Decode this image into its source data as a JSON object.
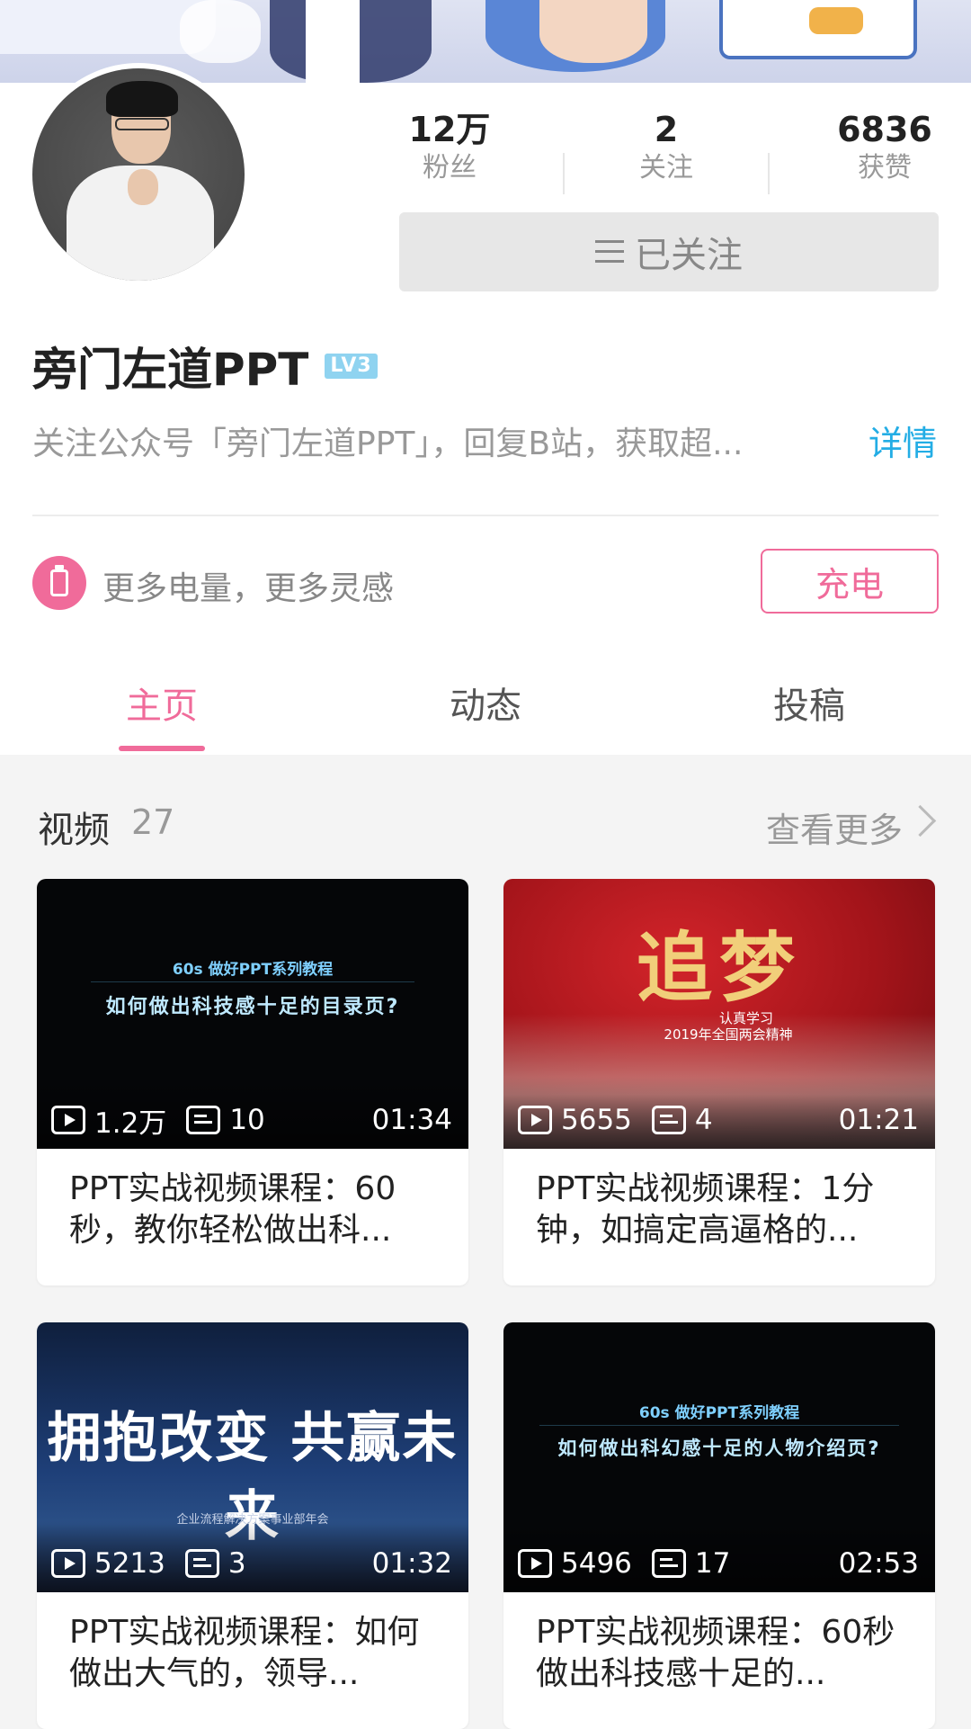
{
  "profile": {
    "stats": [
      {
        "value": "12万",
        "label": "粉丝"
      },
      {
        "value": "2",
        "label": "关注"
      },
      {
        "value": "6836",
        "label": "获赞"
      }
    ],
    "follow_button_label": "已关注",
    "username": "旁门左道PPT",
    "level_badge": "LV3",
    "description": "关注公众号「旁门左道PPT」，回复B站，获取超...",
    "detail_link": "详情",
    "charge_text": "更多电量，更多灵感",
    "charge_button": "充电"
  },
  "tabs": [
    {
      "label": "主页",
      "active": true
    },
    {
      "label": "动态",
      "active": false
    },
    {
      "label": "投稿",
      "active": false
    }
  ],
  "videos_section": {
    "title": "视频",
    "count": "27",
    "more_label": "查看更多"
  },
  "videos": [
    {
      "views": "1.2万",
      "danmaku": "10",
      "duration": "01:34",
      "title": "PPT实战视频课程：60秒，教你轻松做出科...",
      "thumb_lines": [
        "60s 做好PPT系列教程",
        "如何做出科技感十足的目录页?"
      ]
    },
    {
      "views": "5655",
      "danmaku": "4",
      "duration": "01:21",
      "title": "PPT实战视频课程：1分钟，如搞定高逼格的...",
      "thumb_lines": [
        "追梦",
        "认真学习",
        "2019年全国两会精神"
      ]
    },
    {
      "views": "5213",
      "danmaku": "3",
      "duration": "01:32",
      "title": "PPT实战视频课程：如何做出大气的，领导...",
      "thumb_lines": [
        "拥抱改变 共赢未来",
        "企业流程解决方案事业部年会"
      ]
    },
    {
      "views": "5496",
      "danmaku": "17",
      "duration": "02:53",
      "title": "PPT实战视频课程：60秒做出科技感十足的...",
      "thumb_lines": [
        "60s 做好PPT系列教程",
        "如何做出科幻感十足的人物介绍页?"
      ]
    }
  ],
  "colors": {
    "accent_pink": "#f06b9a",
    "link_blue": "#23ade5",
    "level_badge": "#8fd3f0"
  }
}
